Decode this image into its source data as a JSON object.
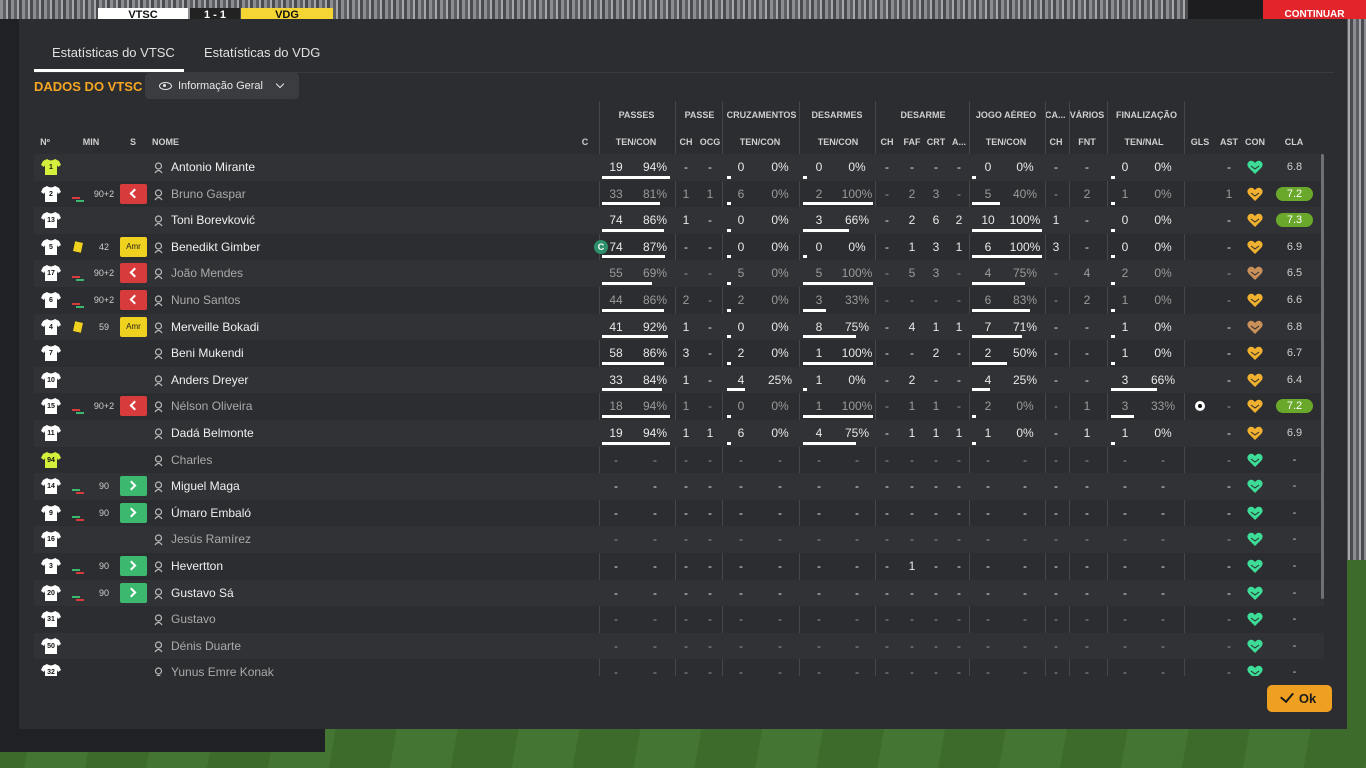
{
  "match": {
    "home": "VTSC",
    "score": "1 - 1",
    "away": "VDG",
    "continue_label": "CONTINUAR"
  },
  "tabs": [
    {
      "label": "Estatísticas do VTSC"
    },
    {
      "label": "Estatísticas do VDG"
    }
  ],
  "section_title": "DADOS DO VTSC",
  "view_select": {
    "value": "Informação Geral"
  },
  "colors": {
    "accent": "#f5a623",
    "sub_out": "#d73b3b",
    "sub_in": "#3cb96e",
    "yellow_card": "#efd21f",
    "rating_high": "#6aa82b",
    "ok": "#f0a020",
    "heart_green": "#3ddc97",
    "heart_gold": "#f0b030"
  },
  "group_headers": [
    "PASSES",
    "PASSE",
    "CRUZAMENTOS",
    "DESARMES",
    "DESARME",
    "JOGO AÉREO",
    "CA...",
    "VÁRIOS",
    "FINALIZAÇÃO"
  ],
  "col_headers": {
    "no": "Nº",
    "min": "MIN",
    "s": "S",
    "nome": "NOME",
    "c": "C",
    "passes": "TEN/CON",
    "passe_ch": "CH",
    "passe_ocg": "OCG",
    "cruz": "TEN/CON",
    "desarmes": "TEN/CON",
    "d_ch": "CH",
    "d_faf": "FAF",
    "d_crt": "CRT",
    "d_a": "A...",
    "aereo": "TEN/CON",
    "ca_ch": "CH",
    "fnt": "FNT",
    "final": "TEN/NAL",
    "gls": "GLS",
    "ast": "AST",
    "con": "CON",
    "cla": "CLA"
  },
  "players": [
    {
      "num": "1",
      "gk": true,
      "min": "",
      "sbadge": "",
      "name": "Antonio Mirante",
      "dim": false,
      "captain": false,
      "pas": [
        "19",
        "94%"
      ],
      "pas_pct": 94,
      "pch": "-",
      "pocg": "-",
      "cru": [
        "0",
        "0%"
      ],
      "cru_pct": 0,
      "des": [
        "0",
        "0%"
      ],
      "des_pct": 0,
      "dch": "-",
      "faf": "-",
      "crt": "-",
      "da": "-",
      "aer": [
        "0",
        "0%"
      ],
      "aer_pct": 0,
      "cach": "-",
      "fnt": "-",
      "fin": [
        "0",
        "0%"
      ],
      "fin_pct": 0,
      "gls": "",
      "goal": false,
      "ast": "-",
      "con": "green",
      "cla": "6.8",
      "cla_hi": false,
      "sub": ""
    },
    {
      "num": "2",
      "gk": false,
      "min": "90+2",
      "sbadge": "out",
      "name": "Bruno Gaspar",
      "dim": true,
      "captain": false,
      "pas": [
        "33",
        "81%"
      ],
      "pas_pct": 81,
      "pch": "1",
      "pocg": "1",
      "cru": [
        "6",
        "0%"
      ],
      "cru_pct": 0,
      "des": [
        "2",
        "100%"
      ],
      "des_pct": 100,
      "dch": "-",
      "faf": "2",
      "crt": "3",
      "da": "-",
      "aer": [
        "5",
        "40%"
      ],
      "aer_pct": 40,
      "cach": "-",
      "fnt": "2",
      "fin": [
        "1",
        "0%"
      ],
      "fin_pct": 0,
      "gls": "",
      "goal": false,
      "ast": "1",
      "con": "gold",
      "cla": "7.2",
      "cla_hi": true,
      "sub": "out"
    },
    {
      "num": "13",
      "gk": false,
      "min": "",
      "sbadge": "",
      "name": "Toni Borevković",
      "dim": false,
      "captain": false,
      "pas": [
        "74",
        "86%"
      ],
      "pas_pct": 86,
      "pch": "1",
      "pocg": "-",
      "cru": [
        "0",
        "0%"
      ],
      "cru_pct": 0,
      "des": [
        "3",
        "66%"
      ],
      "des_pct": 66,
      "dch": "-",
      "faf": "2",
      "crt": "6",
      "da": "2",
      "aer": [
        "10",
        "100%"
      ],
      "aer_pct": 100,
      "cach": "1",
      "fnt": "-",
      "fin": [
        "0",
        "0%"
      ],
      "fin_pct": 0,
      "gls": "",
      "goal": false,
      "ast": "-",
      "con": "gold",
      "cla": "7.3",
      "cla_hi": true,
      "sub": ""
    },
    {
      "num": "5",
      "gk": false,
      "min": "42",
      "sbadge": "amr",
      "name": "Benedikt Gimber",
      "dim": false,
      "captain": true,
      "pas": [
        "74",
        "87%"
      ],
      "pas_pct": 87,
      "pch": "-",
      "pocg": "-",
      "cru": [
        "0",
        "0%"
      ],
      "cru_pct": 0,
      "des": [
        "0",
        "0%"
      ],
      "des_pct": 0,
      "dch": "-",
      "faf": "1",
      "crt": "3",
      "da": "1",
      "aer": [
        "6",
        "100%"
      ],
      "aer_pct": 100,
      "cach": "3",
      "fnt": "-",
      "fin": [
        "0",
        "0%"
      ],
      "fin_pct": 0,
      "gls": "",
      "goal": false,
      "ast": "-",
      "con": "gold",
      "cla": "6.9",
      "cla_hi": false,
      "sub": "card"
    },
    {
      "num": "17",
      "gk": false,
      "min": "90+2",
      "sbadge": "out",
      "name": "João Mendes",
      "dim": true,
      "captain": false,
      "pas": [
        "55",
        "69%"
      ],
      "pas_pct": 69,
      "pch": "-",
      "pocg": "-",
      "cru": [
        "5",
        "0%"
      ],
      "cru_pct": 0,
      "des": [
        "5",
        "100%"
      ],
      "des_pct": 100,
      "dch": "-",
      "faf": "5",
      "crt": "3",
      "da": "-",
      "aer": [
        "4",
        "75%"
      ],
      "aer_pct": 75,
      "cach": "-",
      "fnt": "4",
      "fin": [
        "2",
        "0%"
      ],
      "fin_pct": 0,
      "gls": "",
      "goal": false,
      "ast": "-",
      "con": "brown",
      "cla": "6.5",
      "cla_hi": false,
      "sub": "out"
    },
    {
      "num": "6",
      "gk": false,
      "min": "90+2",
      "sbadge": "out",
      "name": "Nuno Santos",
      "dim": true,
      "captain": false,
      "pas": [
        "44",
        "86%"
      ],
      "pas_pct": 86,
      "pch": "2",
      "pocg": "-",
      "cru": [
        "2",
        "0%"
      ],
      "cru_pct": 0,
      "des": [
        "3",
        "33%"
      ],
      "des_pct": 33,
      "dch": "-",
      "faf": "-",
      "crt": "-",
      "da": "-",
      "aer": [
        "6",
        "83%"
      ],
      "aer_pct": 83,
      "cach": "-",
      "fnt": "2",
      "fin": [
        "1",
        "0%"
      ],
      "fin_pct": 0,
      "gls": "",
      "goal": false,
      "ast": "-",
      "con": "gold",
      "cla": "6.6",
      "cla_hi": false,
      "sub": "out"
    },
    {
      "num": "4",
      "gk": false,
      "min": "59",
      "sbadge": "amr",
      "name": "Merveille Bokadi",
      "dim": false,
      "captain": false,
      "pas": [
        "41",
        "92%"
      ],
      "pas_pct": 92,
      "pch": "1",
      "pocg": "-",
      "cru": [
        "0",
        "0%"
      ],
      "cru_pct": 0,
      "des": [
        "8",
        "75%"
      ],
      "des_pct": 75,
      "dch": "-",
      "faf": "4",
      "crt": "1",
      "da": "1",
      "aer": [
        "7",
        "71%"
      ],
      "aer_pct": 71,
      "cach": "-",
      "fnt": "-",
      "fin": [
        "1",
        "0%"
      ],
      "fin_pct": 0,
      "gls": "",
      "goal": false,
      "ast": "-",
      "con": "brown",
      "cla": "6.8",
      "cla_hi": false,
      "sub": "card"
    },
    {
      "num": "7",
      "gk": false,
      "min": "",
      "sbadge": "",
      "name": "Beni Mukendi",
      "dim": false,
      "captain": false,
      "pas": [
        "58",
        "86%"
      ],
      "pas_pct": 86,
      "pch": "3",
      "pocg": "-",
      "cru": [
        "2",
        "0%"
      ],
      "cru_pct": 0,
      "des": [
        "1",
        "100%"
      ],
      "des_pct": 100,
      "dch": "-",
      "faf": "-",
      "crt": "2",
      "da": "-",
      "aer": [
        "2",
        "50%"
      ],
      "aer_pct": 50,
      "cach": "-",
      "fnt": "-",
      "fin": [
        "1",
        "0%"
      ],
      "fin_pct": 0,
      "gls": "",
      "goal": false,
      "ast": "-",
      "con": "gold",
      "cla": "6.7",
      "cla_hi": false,
      "sub": ""
    },
    {
      "num": "10",
      "gk": false,
      "min": "",
      "sbadge": "",
      "name": "Anders Dreyer",
      "dim": false,
      "captain": false,
      "pas": [
        "33",
        "84%"
      ],
      "pas_pct": 84,
      "pch": "1",
      "pocg": "-",
      "cru": [
        "4",
        "25%"
      ],
      "cru_pct": 25,
      "des": [
        "1",
        "0%"
      ],
      "des_pct": 0,
      "dch": "-",
      "faf": "2",
      "crt": "-",
      "da": "-",
      "aer": [
        "4",
        "25%"
      ],
      "aer_pct": 25,
      "cach": "-",
      "fnt": "-",
      "fin": [
        "3",
        "66%"
      ],
      "fin_pct": 66,
      "gls": "",
      "goal": false,
      "ast": "-",
      "con": "gold",
      "cla": "6.4",
      "cla_hi": false,
      "sub": ""
    },
    {
      "num": "15",
      "gk": false,
      "min": "90+2",
      "sbadge": "out",
      "name": "Nélson Oliveira",
      "dim": true,
      "captain": false,
      "pas": [
        "18",
        "94%"
      ],
      "pas_pct": 94,
      "pch": "1",
      "pocg": "-",
      "cru": [
        "0",
        "0%"
      ],
      "cru_pct": 0,
      "des": [
        "1",
        "100%"
      ],
      "des_pct": 100,
      "dch": "-",
      "faf": "1",
      "crt": "1",
      "da": "-",
      "aer": [
        "2",
        "0%"
      ],
      "aer_pct": 0,
      "cach": "-",
      "fnt": "1",
      "fin": [
        "3",
        "33%"
      ],
      "fin_pct": 33,
      "gls": "",
      "goal": true,
      "ast": "-",
      "con": "gold",
      "cla": "7.2",
      "cla_hi": true,
      "sub": "out"
    },
    {
      "num": "11",
      "gk": false,
      "min": "",
      "sbadge": "",
      "name": "Dadá Belmonte",
      "dim": false,
      "captain": false,
      "pas": [
        "19",
        "94%"
      ],
      "pas_pct": 94,
      "pch": "1",
      "pocg": "1",
      "cru": [
        "6",
        "0%"
      ],
      "cru_pct": 0,
      "des": [
        "4",
        "75%"
      ],
      "des_pct": 75,
      "dch": "-",
      "faf": "1",
      "crt": "1",
      "da": "1",
      "aer": [
        "1",
        "0%"
      ],
      "aer_pct": 0,
      "cach": "-",
      "fnt": "1",
      "fin": [
        "1",
        "0%"
      ],
      "fin_pct": 0,
      "gls": "",
      "goal": false,
      "ast": "-",
      "con": "gold",
      "cla": "6.9",
      "cla_hi": false,
      "sub": ""
    },
    {
      "num": "94",
      "gk": true,
      "min": "",
      "sbadge": "",
      "name": "Charles",
      "dim": true,
      "captain": false,
      "pas": [
        "-",
        "-"
      ],
      "pas_pct": -1,
      "pch": "-",
      "pocg": "-",
      "cru": [
        "-",
        "-"
      ],
      "cru_pct": -1,
      "des": [
        "-",
        "-"
      ],
      "des_pct": -1,
      "dch": "-",
      "faf": "-",
      "crt": "-",
      "da": "-",
      "aer": [
        "-",
        "-"
      ],
      "aer_pct": -1,
      "cach": "-",
      "fnt": "-",
      "fin": [
        "-",
        "-"
      ],
      "fin_pct": -1,
      "gls": "",
      "goal": false,
      "ast": "-",
      "con": "green",
      "cla": "-",
      "cla_hi": false,
      "sub": ""
    },
    {
      "num": "14",
      "gk": false,
      "min": "90",
      "sbadge": "in",
      "name": "Miguel Maga",
      "dim": false,
      "captain": false,
      "pas": [
        "-",
        "-"
      ],
      "pas_pct": -1,
      "pch": "-",
      "pocg": "-",
      "cru": [
        "-",
        "-"
      ],
      "cru_pct": -1,
      "des": [
        "-",
        "-"
      ],
      "des_pct": -1,
      "dch": "-",
      "faf": "-",
      "crt": "-",
      "da": "-",
      "aer": [
        "-",
        "-"
      ],
      "aer_pct": -1,
      "cach": "-",
      "fnt": "-",
      "fin": [
        "-",
        "-"
      ],
      "fin_pct": -1,
      "gls": "",
      "goal": false,
      "ast": "-",
      "con": "green",
      "cla": "-",
      "cla_hi": false,
      "sub": "in"
    },
    {
      "num": "9",
      "gk": false,
      "min": "90",
      "sbadge": "in",
      "name": "Úmaro Embaló",
      "dim": false,
      "captain": false,
      "pas": [
        "-",
        "-"
      ],
      "pas_pct": -1,
      "pch": "-",
      "pocg": "-",
      "cru": [
        "-",
        "-"
      ],
      "cru_pct": -1,
      "des": [
        "-",
        "-"
      ],
      "des_pct": -1,
      "dch": "-",
      "faf": "-",
      "crt": "-",
      "da": "-",
      "aer": [
        "-",
        "-"
      ],
      "aer_pct": -1,
      "cach": "-",
      "fnt": "-",
      "fin": [
        "-",
        "-"
      ],
      "fin_pct": -1,
      "gls": "",
      "goal": false,
      "ast": "-",
      "con": "green",
      "cla": "-",
      "cla_hi": false,
      "sub": "in"
    },
    {
      "num": "16",
      "gk": false,
      "min": "",
      "sbadge": "",
      "name": "Jesús Ramírez",
      "dim": true,
      "captain": false,
      "pas": [
        "-",
        "-"
      ],
      "pas_pct": -1,
      "pch": "-",
      "pocg": "-",
      "cru": [
        "-",
        "-"
      ],
      "cru_pct": -1,
      "des": [
        "-",
        "-"
      ],
      "des_pct": -1,
      "dch": "-",
      "faf": "-",
      "crt": "-",
      "da": "-",
      "aer": [
        "-",
        "-"
      ],
      "aer_pct": -1,
      "cach": "-",
      "fnt": "-",
      "fin": [
        "-",
        "-"
      ],
      "fin_pct": -1,
      "gls": "",
      "goal": false,
      "ast": "-",
      "con": "green",
      "cla": "-",
      "cla_hi": false,
      "sub": ""
    },
    {
      "num": "3",
      "gk": false,
      "min": "90",
      "sbadge": "in",
      "name": "Hevertton",
      "dim": false,
      "captain": false,
      "pas": [
        "-",
        "-"
      ],
      "pas_pct": -1,
      "pch": "-",
      "pocg": "-",
      "cru": [
        "-",
        "-"
      ],
      "cru_pct": -1,
      "des": [
        "-",
        "-"
      ],
      "des_pct": -1,
      "dch": "-",
      "faf": "1",
      "crt": "-",
      "da": "-",
      "aer": [
        "-",
        "-"
      ],
      "aer_pct": -1,
      "cach": "-",
      "fnt": "-",
      "fin": [
        "-",
        "-"
      ],
      "fin_pct": -1,
      "gls": "",
      "goal": false,
      "ast": "-",
      "con": "green",
      "cla": "-",
      "cla_hi": false,
      "sub": "in"
    },
    {
      "num": "20",
      "gk": false,
      "min": "90",
      "sbadge": "in",
      "name": "Gustavo Sá",
      "dim": false,
      "captain": false,
      "pas": [
        "-",
        "-"
      ],
      "pas_pct": -1,
      "pch": "-",
      "pocg": "-",
      "cru": [
        "-",
        "-"
      ],
      "cru_pct": -1,
      "des": [
        "-",
        "-"
      ],
      "des_pct": -1,
      "dch": "-",
      "faf": "-",
      "crt": "-",
      "da": "-",
      "aer": [
        "-",
        "-"
      ],
      "aer_pct": -1,
      "cach": "-",
      "fnt": "-",
      "fin": [
        "-",
        "-"
      ],
      "fin_pct": -1,
      "gls": "",
      "goal": false,
      "ast": "-",
      "con": "green",
      "cla": "-",
      "cla_hi": false,
      "sub": "in"
    },
    {
      "num": "31",
      "gk": false,
      "min": "",
      "sbadge": "",
      "name": "Gustavo",
      "dim": true,
      "captain": false,
      "pas": [
        "-",
        "-"
      ],
      "pas_pct": -1,
      "pch": "-",
      "pocg": "-",
      "cru": [
        "-",
        "-"
      ],
      "cru_pct": -1,
      "des": [
        "-",
        "-"
      ],
      "des_pct": -1,
      "dch": "-",
      "faf": "-",
      "crt": "-",
      "da": "-",
      "aer": [
        "-",
        "-"
      ],
      "aer_pct": -1,
      "cach": "-",
      "fnt": "-",
      "fin": [
        "-",
        "-"
      ],
      "fin_pct": -1,
      "gls": "",
      "goal": false,
      "ast": "-",
      "con": "green",
      "cla": "-",
      "cla_hi": false,
      "sub": ""
    },
    {
      "num": "50",
      "gk": false,
      "min": "",
      "sbadge": "",
      "name": "Dénis Duarte",
      "dim": true,
      "captain": false,
      "pas": [
        "-",
        "-"
      ],
      "pas_pct": -1,
      "pch": "-",
      "pocg": "-",
      "cru": [
        "-",
        "-"
      ],
      "cru_pct": -1,
      "des": [
        "-",
        "-"
      ],
      "des_pct": -1,
      "dch": "-",
      "faf": "-",
      "crt": "-",
      "da": "-",
      "aer": [
        "-",
        "-"
      ],
      "aer_pct": -1,
      "cach": "-",
      "fnt": "-",
      "fin": [
        "-",
        "-"
      ],
      "fin_pct": -1,
      "gls": "",
      "goal": false,
      "ast": "-",
      "con": "green",
      "cla": "-",
      "cla_hi": false,
      "sub": ""
    },
    {
      "num": "32",
      "gk": false,
      "min": "",
      "sbadge": "",
      "name": "Yunus Emre Konak",
      "dim": true,
      "captain": false,
      "pas": [
        "-",
        "-"
      ],
      "pas_pct": -1,
      "pch": "-",
      "pocg": "-",
      "cru": [
        "-",
        "-"
      ],
      "cru_pct": -1,
      "des": [
        "-",
        "-"
      ],
      "des_pct": -1,
      "dch": "-",
      "faf": "-",
      "crt": "-",
      "da": "-",
      "aer": [
        "-",
        "-"
      ],
      "aer_pct": -1,
      "cach": "-",
      "fnt": "-",
      "fin": [
        "-",
        "-"
      ],
      "fin_pct": -1,
      "gls": "",
      "goal": false,
      "ast": "-",
      "con": "green",
      "cla": "-",
      "cla_hi": false,
      "sub": ""
    }
  ],
  "badge_text": {
    "amr": "Amr",
    "captain": "C"
  },
  "ok_label": "Ok"
}
